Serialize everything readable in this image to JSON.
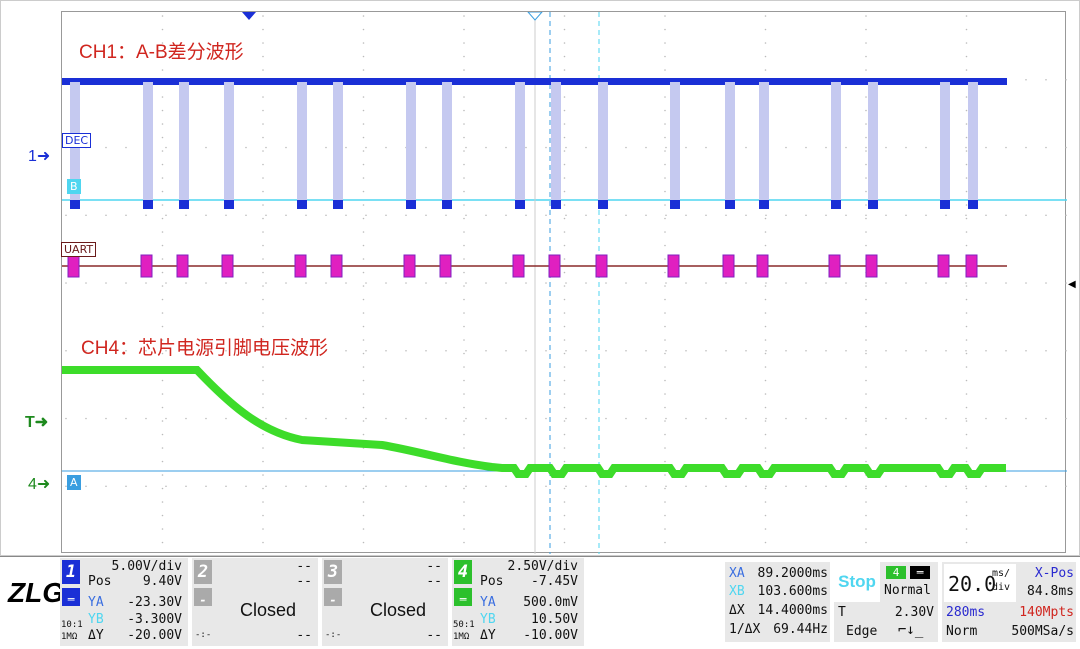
{
  "screen": {
    "ch1_note": "CH1：A-B差分波形",
    "ch4_note": "CH4：芯片电源引脚电压波形",
    "ch1_marker": "1",
    "ch4_marker": "4",
    "trigger_marker": "T",
    "dec_tag": "DEC",
    "b_tag": "B",
    "a_tag": "A",
    "uart_tag": "UART",
    "colors": {
      "ch1": "#1a2fd6",
      "ch4": "#3ddc2a",
      "uart": "#e020c0",
      "cursor": "#2aa8e0",
      "note": "#d0261f"
    }
  },
  "panel": {
    "logo": "ZLG",
    "ch1": {
      "num": "1",
      "vdiv": "5.00V/div",
      "pos_label": "Pos",
      "pos": "9.40V",
      "ya_label": "YA",
      "ya": "-23.30V",
      "yb_label": "YB",
      "yb": "-3.300V",
      "dy_label": "ΔY",
      "dy": "-20.00V",
      "probe": "10:1",
      "imp": "1MΩ"
    },
    "ch2": {
      "num": "2",
      "a": "--",
      "b": "--",
      "state": "Closed",
      "c": "--",
      "d": "-:-",
      "minus": "-"
    },
    "ch3": {
      "num": "3",
      "a": "--",
      "b": "--",
      "state": "Closed",
      "c": "--",
      "d": "-:-",
      "minus": "-"
    },
    "ch4": {
      "num": "4",
      "vdiv": "2.50V/div",
      "pos_label": "Pos",
      "pos": "-7.45V",
      "ya_label": "YA",
      "ya": "500.0mV",
      "yb_label": "YB",
      "yb": "10.50V",
      "dy_label": "ΔY",
      "dy": "-10.00V",
      "probe": "50:1",
      "imp": "1MΩ"
    },
    "cursors": {
      "xa_label": "XA",
      "xa": "89.2000ms",
      "xb_label": "XB",
      "xb": "103.600ms",
      "dx_label": "ΔX",
      "dx": "14.4000ms",
      "inv_label": "1/ΔX",
      "inv": "69.44Hz"
    },
    "trigger": {
      "run_state": "Stop",
      "source": "4",
      "mode": "Normal",
      "t_label": "T",
      "level": "2.30V",
      "type": "Edge"
    },
    "timebase": {
      "value": "20.0",
      "unit_top": "ms/",
      "unit_bottom": "div",
      "xpos_label": "X-Pos",
      "xpos": "84.8ms",
      "span": "280ms",
      "mem": "140Mpts",
      "acq": "Norm",
      "rate": "500MSa/s"
    }
  }
}
